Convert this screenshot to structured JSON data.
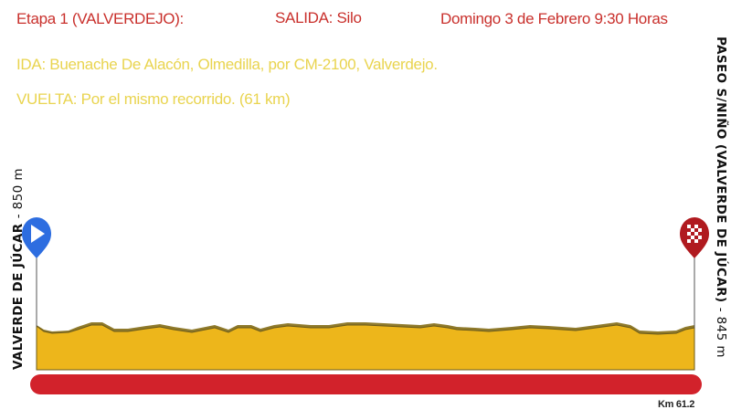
{
  "header": {
    "stage": "Etapa 1   (VALVERDEJO):",
    "start": "SALIDA: Silo",
    "date": "Domingo 3 de Febrero 9:30 Horas"
  },
  "route": {
    "outbound": "IDA: Buenache De Alacón, Olmedilla, por CM-2100, Valverdejo.",
    "return": "VUELTA: Por el mismo recorrido. (61 km)"
  },
  "profile": {
    "start_name": "VALVERDE DE JÚCAR",
    "start_altitude": "850 m",
    "finish_name": "PASEO S/NIÑO (VALVERDE DE JÚCAR)",
    "finish_altitude": "845 m",
    "distance_label": "Km 61.2",
    "start_icon": "play-flag-icon",
    "finish_icon": "checkered-flag-icon"
  },
  "colors": {
    "title_red": "#c9302c",
    "route_yellow": "#e9d44f",
    "profile_fill": "#edb61b",
    "distance_bar": "#d2222b",
    "start_marker": "#2d6de0",
    "finish_marker": "#b01a1f"
  }
}
